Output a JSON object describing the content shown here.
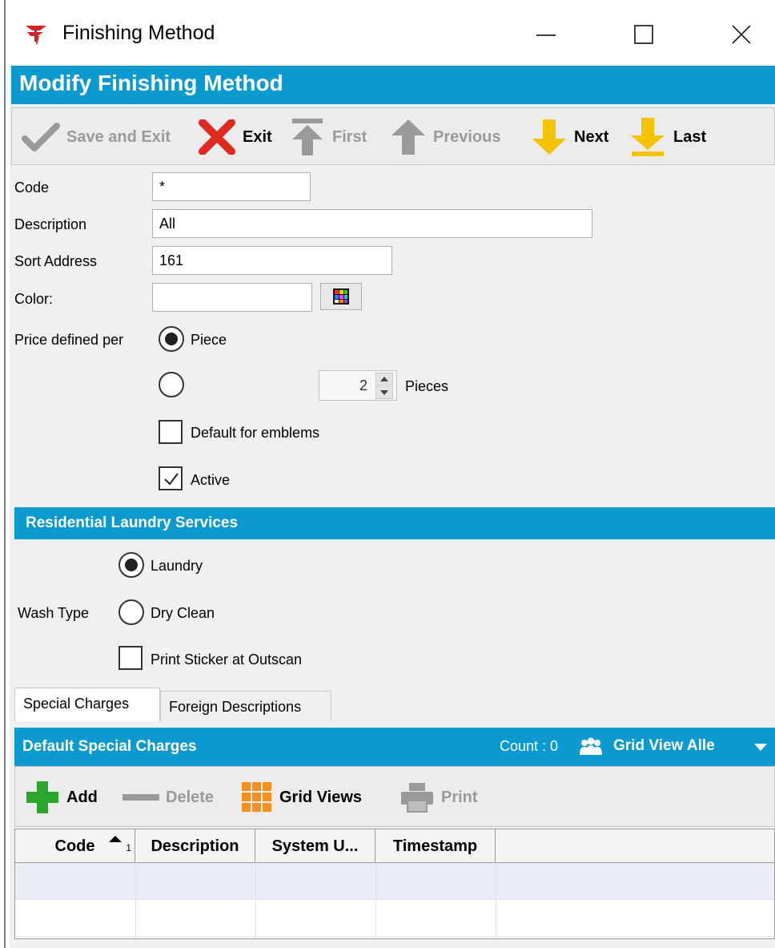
{
  "window": {
    "title": "Finishing Method",
    "controls": [
      "minimize",
      "maximize",
      "close"
    ]
  },
  "header": {
    "title": "Modify Finishing Method"
  },
  "toolbar": {
    "save_exit": "Save and Exit",
    "exit": "Exit",
    "first": "First",
    "previous": "Previous",
    "next": "Next",
    "last": "Last"
  },
  "form": {
    "code_label": "Code",
    "code_value": "*",
    "description_label": "Description",
    "description_value": "All",
    "sort_address_label": "Sort Address",
    "sort_address_value": "161",
    "color_label": "Color:",
    "color_value": "",
    "price_defined_label": "Price defined per",
    "price_option_piece": "Piece",
    "price_option_piece_selected": true,
    "pieces_count": "2",
    "pieces_label": "Pieces",
    "default_emblems_label": "Default for emblems",
    "default_emblems_checked": false,
    "active_label": "Active",
    "active_checked": true
  },
  "residential": {
    "section_title": "Residential Laundry Services",
    "wash_type_label": "Wash Type",
    "laundry_label": "Laundry",
    "laundry_selected": true,
    "dry_clean_label": "Dry Clean",
    "print_sticker_label": "Print Sticker at Outscan",
    "print_sticker_checked": false
  },
  "tabs": {
    "special_charges": "Special Charges",
    "foreign_descriptions": "Foreign Descriptions"
  },
  "grid": {
    "title": "Default Special Charges",
    "count": "Count : 0",
    "grid_view": "Grid View Alle",
    "add": "Add",
    "delete": "Delete",
    "grid_views": "Grid Views",
    "print": "Print",
    "columns": [
      "Code",
      "Description",
      "System U...",
      "Timestamp"
    ],
    "sort_indicator": "1"
  },
  "colors": {
    "accent_blue": "#0b9ad0",
    "next_yellow": "#f5c400",
    "add_green": "#2aa62a",
    "exit_red": "#e12a1f",
    "grid_orange": "#f5901e"
  }
}
